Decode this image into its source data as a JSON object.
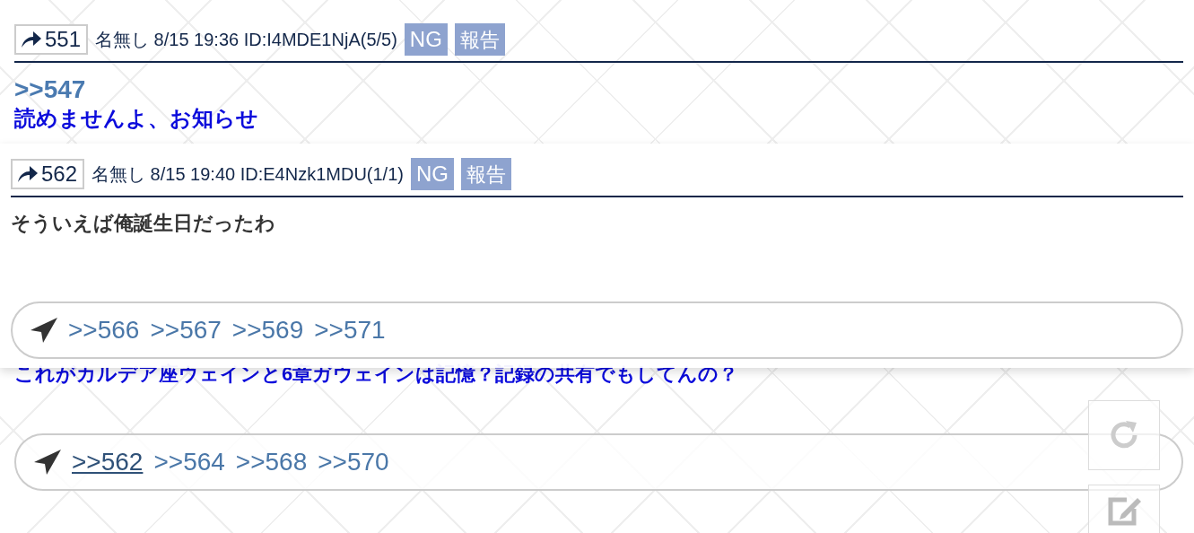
{
  "thread": {
    "post": {
      "number": "551",
      "name": "名無し",
      "date": "8/15 19:36",
      "id": "ID:I4MDE1NjA(5/5)",
      "ng": "NG",
      "report": "報告",
      "body": [
        {
          "kind": "anchor",
          "text": ">>547"
        },
        {
          "kind": "link",
          "text": "読めませんよ、お知らせ"
        }
      ]
    },
    "next_body": "これがカルデア座ウェインと6章ガウェインは記憶？記録の共有でもしてんの？",
    "replies": [
      {
        "text": ">>562",
        "hovered": true
      },
      {
        "text": ">>564",
        "hovered": false
      },
      {
        "text": ">>568",
        "hovered": false
      },
      {
        "text": ">>570",
        "hovered": false
      }
    ]
  },
  "popup": {
    "post": {
      "number": "562",
      "name": "名無し",
      "date": "8/15 19:40",
      "id": "ID:E4Nzk1MDU(1/1)",
      "ng": "NG",
      "report": "報告",
      "body": [
        {
          "kind": "text",
          "text": "そういえば俺誕生日だったわ"
        }
      ]
    },
    "replies": [
      {
        "text": ">>566",
        "hovered": false
      },
      {
        "text": ">>567",
        "hovered": false
      },
      {
        "text": ">>569",
        "hovered": false
      },
      {
        "text": ">>571",
        "hovered": false
      }
    ]
  }
}
